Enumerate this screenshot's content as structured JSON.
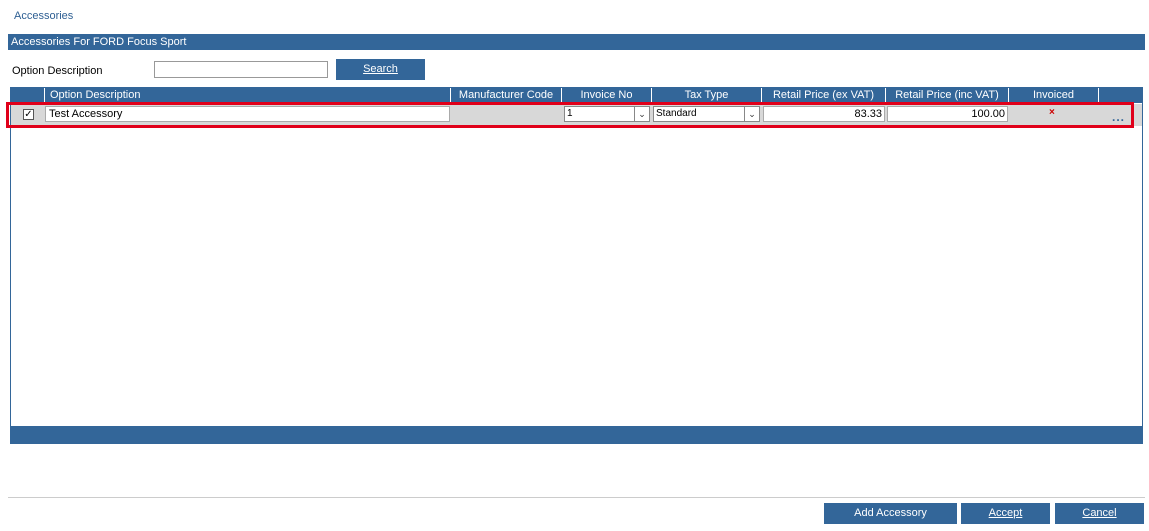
{
  "page": {
    "title": "Accessories"
  },
  "section": {
    "header": "Accessories For FORD Focus Sport"
  },
  "search": {
    "label": "Option Description",
    "value": "",
    "placeholder": "",
    "button_label": "Search"
  },
  "table": {
    "columns": [
      "Option Description",
      "Manufacturer Code",
      "Invoice No",
      "Tax Type",
      "Retail Price (ex VAT)",
      "Retail Price (inc VAT)",
      "Invoiced"
    ],
    "rows": [
      {
        "checked": "✓",
        "option_description": "Test Accessory",
        "manufacturer_code": "",
        "invoice_no": "1",
        "tax_type": "Standard",
        "price_ex_vat": "83.33",
        "price_inc_vat": "100.00",
        "invoiced_mark": "×",
        "more": "..."
      }
    ]
  },
  "icons": {
    "dropdown": "chevron-down-icon",
    "invoiced": "x-icon",
    "more": "ellipsis-icon",
    "checkbox": "checkmark-icon"
  },
  "colors": {
    "accent": "#336699",
    "highlight": "#e0001a",
    "row_bg": "#d8d8d8"
  },
  "footer": {
    "add_label": "Add Accessory",
    "accept_label": "Accept",
    "cancel_label": "Cancel"
  }
}
